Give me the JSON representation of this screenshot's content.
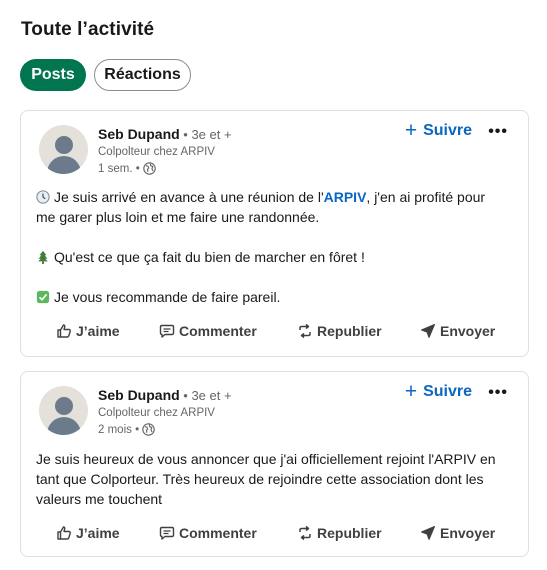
{
  "page": {
    "title": "Toute l’activité"
  },
  "filters": {
    "posts": "Posts",
    "reactions": "Réactions"
  },
  "posts": [
    {
      "author": "Seb Dupand",
      "degree": " • 3e et +",
      "headline": "Colpolteur chez ARPIV",
      "time": "1 sem. •",
      "follow": "Suivre",
      "more": "•••",
      "content": {
        "l1_pre": "Je suis arrivé en avance à une réunion de l'",
        "l1_link": "ARPIV",
        "l1_post": ", j'en ai profité pour me garer plus loin et me faire une randonnée.",
        "l2": "Qu'est ce que ça fait du bien de marcher en fôret !",
        "l3": "Je vous recommande de faire pareil."
      },
      "actions": {
        "like": "J’aime",
        "comment": "Commenter",
        "repost": "Republier",
        "send": "Envoyer"
      }
    },
    {
      "author": "Seb Dupand",
      "degree": " • 3e et +",
      "headline": "Colpolteur chez ARPIV",
      "time": "2 mois •",
      "follow": "Suivre",
      "more": "•••",
      "content": {
        "text": "Je suis heureux de vous annoncer que j'ai officiellement rejoint l'ARPIV en tant que Colporteur. Très heureux de rejoindre cette association dont les valeurs me touchent"
      },
      "actions": {
        "like": "J’aime",
        "comment": "Commenter",
        "repost": "Republier",
        "send": "Envoyer"
      }
    }
  ],
  "colors": {
    "accent": "#01754f",
    "link": "#0a66c2",
    "text": "#191919",
    "muted": "#666666"
  }
}
